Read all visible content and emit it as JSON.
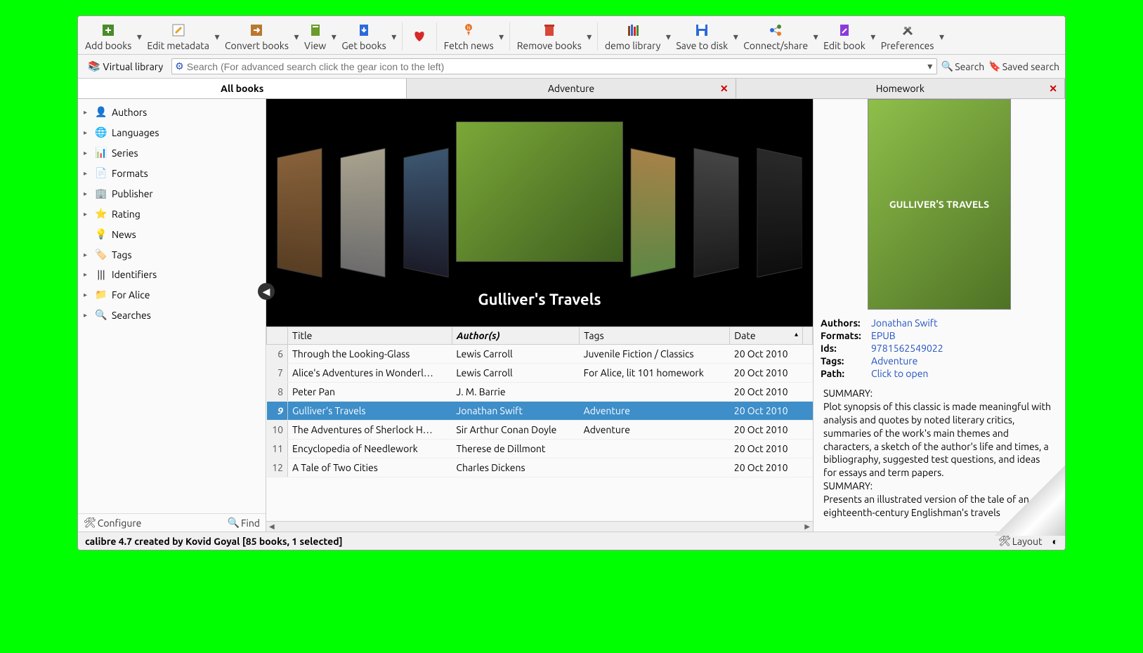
{
  "toolbar": [
    {
      "label": "Add books",
      "icon": "add"
    },
    {
      "label": "Edit metadata",
      "icon": "edit"
    },
    {
      "label": "Convert books",
      "icon": "convert"
    },
    {
      "label": "View",
      "icon": "view"
    },
    {
      "label": "Get books",
      "icon": "get"
    },
    {
      "label": "",
      "icon": "heart",
      "nodd": true
    },
    {
      "label": "Fetch news",
      "icon": "news"
    },
    {
      "label": "Remove books",
      "icon": "remove"
    },
    {
      "label": "demo library",
      "icon": "library"
    },
    {
      "label": "Save to disk",
      "icon": "save"
    },
    {
      "label": "Connect/share",
      "icon": "share"
    },
    {
      "label": "Edit book",
      "icon": "editbook"
    },
    {
      "label": "Preferences",
      "icon": "prefs"
    }
  ],
  "virtual_library": "Virtual library",
  "search_placeholder": "Search (For advanced search click the gear icon to the left)",
  "search_btn": "Search",
  "saved_search": "Saved search",
  "tabs": [
    {
      "label": "All books",
      "active": true,
      "close": false
    },
    {
      "label": "Adventure",
      "active": false,
      "close": true
    },
    {
      "label": "Homework",
      "active": false,
      "close": true
    }
  ],
  "sidebar_items": [
    {
      "label": "Authors",
      "icon": "👤",
      "arrow": true
    },
    {
      "label": "Languages",
      "icon": "🌐",
      "arrow": true
    },
    {
      "label": "Series",
      "icon": "📊",
      "arrow": true
    },
    {
      "label": "Formats",
      "icon": "📄",
      "arrow": true
    },
    {
      "label": "Publisher",
      "icon": "🏢",
      "arrow": true
    },
    {
      "label": "Rating",
      "icon": "⭐",
      "arrow": true
    },
    {
      "label": "News",
      "icon": "💡",
      "arrow": false
    },
    {
      "label": "Tags",
      "icon": "🏷️",
      "arrow": true
    },
    {
      "label": "Identifiers",
      "icon": "|||",
      "arrow": true
    },
    {
      "label": "For Alice",
      "icon": "📁",
      "arrow": true
    },
    {
      "label": "Searches",
      "icon": "🔍",
      "arrow": true
    }
  ],
  "configure": "Configure",
  "find": "Find",
  "cover_title": "Gulliver's Travels",
  "columns": [
    "Title",
    "Author(s)",
    "Tags",
    "Date"
  ],
  "rows": [
    {
      "n": 6,
      "title": "Through the Looking-Glass",
      "author": "Lewis Carroll",
      "tags": "Juvenile Fiction / Classics",
      "date": "20 Oct 2010"
    },
    {
      "n": 7,
      "title": "Alice's Adventures in Wonderl…",
      "author": "Lewis Carroll",
      "tags": "For Alice, lit 101 homework",
      "date": "20 Oct 2010"
    },
    {
      "n": 8,
      "title": "Peter Pan",
      "author": "J. M. Barrie",
      "tags": "",
      "date": "20 Oct 2010"
    },
    {
      "n": 9,
      "title": "Gulliver's Travels",
      "author": "Jonathan Swift",
      "tags": "Adventure",
      "date": "20 Oct 2010",
      "selected": true
    },
    {
      "n": 10,
      "title": "The Adventures of Sherlock H…",
      "author": "Sir Arthur Conan Doyle",
      "tags": "Adventure",
      "date": "20 Oct 2010"
    },
    {
      "n": 11,
      "title": "Encyclopedia of Needlework",
      "author": "Therese de Dillmont",
      "tags": "",
      "date": "20 Oct 2010"
    },
    {
      "n": 12,
      "title": "A Tale of Two Cities",
      "author": "Charles Dickens",
      "tags": "",
      "date": "20 Oct 2010"
    }
  ],
  "details": {
    "cover_text": "GULLIVER'S TRAVELS",
    "authors_label": "Authors:",
    "authors": "Jonathan Swift",
    "formats_label": "Formats:",
    "formats": "EPUB",
    "ids_label": "Ids:",
    "ids": "9781562549022",
    "tags_label": "Tags:",
    "tags": "Adventure",
    "path_label": "Path:",
    "path": "Click to open",
    "summary_label": "SUMMARY:",
    "summary1": "Plot synopsis of this classic is made meaningful with analysis and quotes by noted literary critics, summaries of the work's main themes and characters, a sketch of the author's life and times, a bibliography, suggested test questions, and ideas for essays and term papers.",
    "summary_label2": "SUMMARY:",
    "summary2": "Presents an illustrated version of the tale of an eighteenth-century Englishman's travels"
  },
  "status_left": "calibre 4.7 created by Kovid Goyal   [85 books, 1 selected]",
  "layout": "Layout"
}
